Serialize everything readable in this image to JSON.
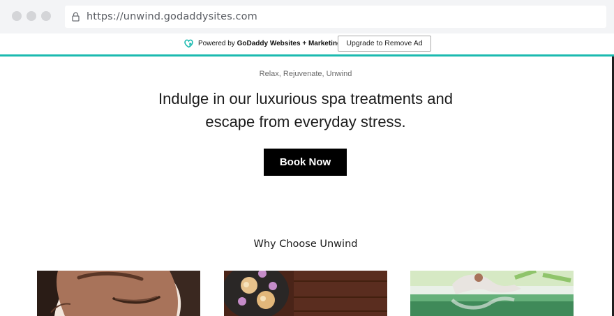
{
  "browser": {
    "url": "https://unwind.godaddysites.com"
  },
  "ad_bar": {
    "powered_prefix": "Powered by",
    "powered_brand": "GoDaddy Websites + Marketing.",
    "upgrade_label": "Upgrade to Remove Ad",
    "accent_color": "#1bbab0"
  },
  "hero": {
    "tagline": "Relax, Rejuvenate, Unwind",
    "headline": "Indulge in our luxurious spa treatments and escape from everyday stress.",
    "cta_label": "Book Now"
  },
  "features": {
    "title": "Why Choose Unwind",
    "cards": [
      {
        "image": "face-relaxing-photo"
      },
      {
        "image": "candles-flowers-photo"
      },
      {
        "image": "yoga-pool-photo"
      }
    ]
  }
}
